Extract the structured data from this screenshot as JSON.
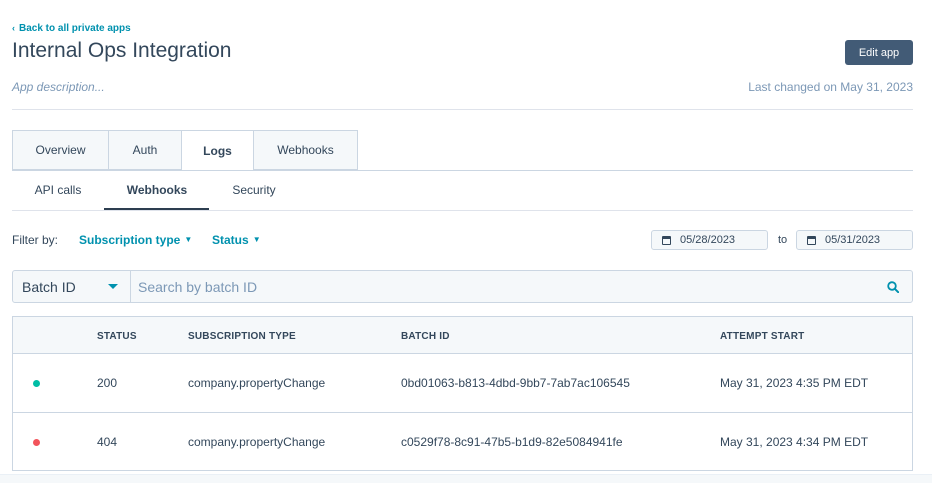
{
  "header": {
    "back_label": "Back to all private apps",
    "title": "Internal Ops Integration",
    "edit_label": "Edit app",
    "description": "App description...",
    "last_changed": "Last changed on May 31, 2023"
  },
  "tabs": [
    {
      "label": "Overview",
      "active": false
    },
    {
      "label": "Auth",
      "active": false
    },
    {
      "label": "Logs",
      "active": true
    },
    {
      "label": "Webhooks",
      "active": false
    }
  ],
  "subtabs": [
    {
      "label": "API calls",
      "active": false
    },
    {
      "label": "Webhooks",
      "active": true
    },
    {
      "label": "Security",
      "active": false
    }
  ],
  "filters": {
    "label": "Filter by:",
    "subscription_type": "Subscription type",
    "status": "Status",
    "date_from": "05/28/2023",
    "date_to_label": "to",
    "date_to": "05/31/2023"
  },
  "search": {
    "field_selected": "Batch ID",
    "placeholder": "Search by batch ID"
  },
  "table": {
    "columns": [
      "STATUS",
      "SUBSCRIPTION TYPE",
      "BATCH ID",
      "ATTEMPT START"
    ],
    "rows": [
      {
        "indicator_color": "#00bda5",
        "status": "200",
        "subscription_type": "company.propertyChange",
        "batch_id": "0bd01063-b813-4dbd-9bb7-7ab7ac106545",
        "attempt_start": "May 31, 2023 4:35 PM EDT"
      },
      {
        "indicator_color": "#f2545b",
        "status": "404",
        "subscription_type": "company.propertyChange",
        "batch_id": "c0529f78-8c91-47b5-b1d9-82e5084941fe",
        "attempt_start": "May 31, 2023 4:34 PM EDT"
      }
    ]
  },
  "colors": {
    "accent": "#0091ae",
    "primary_button": "#425b76",
    "success": "#00bda5",
    "error": "#f2545b",
    "text": "#33475b"
  }
}
